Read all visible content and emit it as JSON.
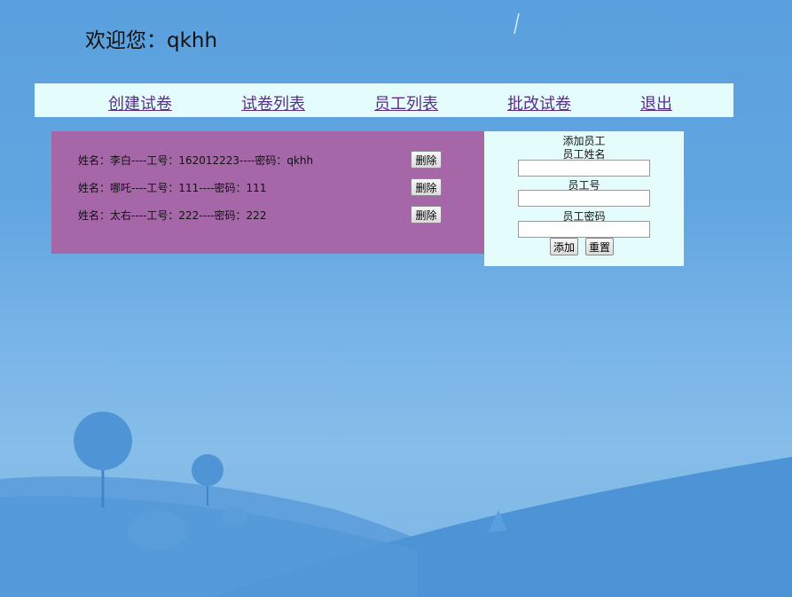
{
  "welcome": {
    "text": "欢迎您：qkhh"
  },
  "nav": [
    {
      "label": "创建试卷"
    },
    {
      "label": "试卷列表"
    },
    {
      "label": "员工列表"
    },
    {
      "label": "批改试卷"
    },
    {
      "label": "退出"
    }
  ],
  "employees": [
    {
      "info": "姓名：李白----工号：162012223----密码：qkhh",
      "delete_label": "删除"
    },
    {
      "info": "姓名：哪吒----工号：111----密码：111",
      "delete_label": "删除"
    },
    {
      "info": "姓名：太右----工号：222----密码：222",
      "delete_label": "删除"
    }
  ],
  "add_form": {
    "title": "添加员工",
    "name_label": "员工姓名",
    "id_label": "员工号",
    "password_label": "员工密码",
    "name_value": "",
    "id_value": "",
    "password_value": "",
    "add_label": "添加",
    "reset_label": "重置"
  },
  "colors": {
    "nav_bg": "#e4fdfc",
    "list_bg": "#a667a9",
    "form_bg": "#e4fdfc",
    "link": "#5a2c8a"
  }
}
